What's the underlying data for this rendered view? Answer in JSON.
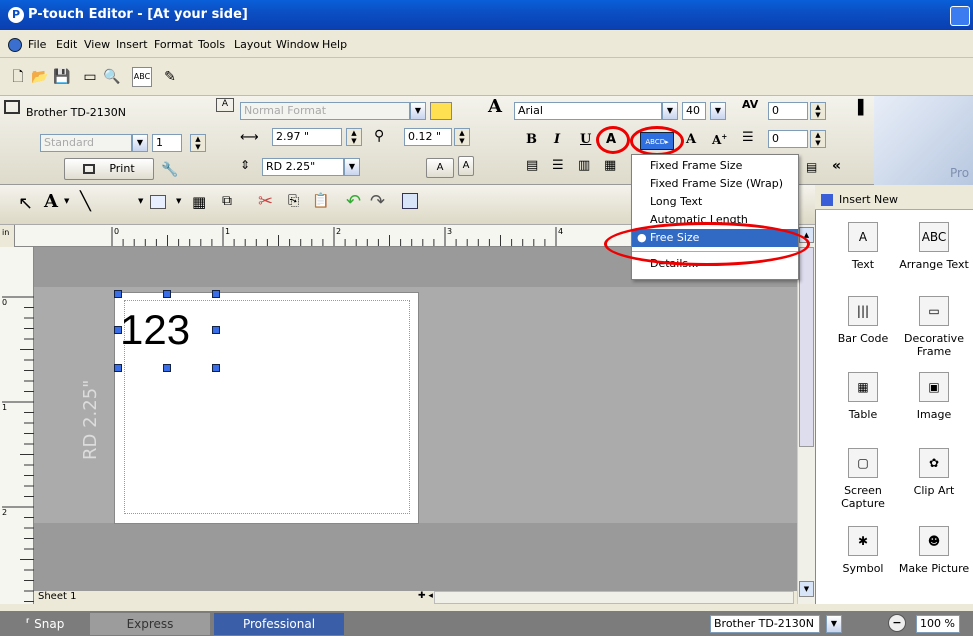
{
  "window": {
    "title": "P-touch Editor - [At your side]"
  },
  "menu": [
    "File",
    "Edit",
    "View",
    "Insert",
    "Format",
    "Tools",
    "Layout",
    "Window",
    "Help"
  ],
  "printer": {
    "name": "Brother TD-2130N",
    "mode": "Standard",
    "copies": "1",
    "print_label": "Print"
  },
  "paper": {
    "format": "Normal Format",
    "width": "2.97 \"",
    "margin": "0.12 \"",
    "media": "RD 2.25\""
  },
  "font": {
    "name": "Arial",
    "size": "40",
    "spacing1": "0",
    "spacing2": "0"
  },
  "dropdown": {
    "items": [
      "Fixed Frame Size",
      "Fixed Frame Size (Wrap)",
      "Long Text",
      "Automatic Length",
      "Free Size",
      "Details..."
    ],
    "selected": "Free Size"
  },
  "ruler": {
    "unit": "in",
    "ticks": [
      "0",
      "1",
      "2",
      "3",
      "4"
    ],
    "vticks": [
      "0",
      "1",
      "2"
    ]
  },
  "canvas": {
    "text": "123",
    "side_label": "RD 2.25\"",
    "sheet_tab": "Sheet 1"
  },
  "panel": {
    "title": "Insert New",
    "pro_text": "Pro",
    "items": [
      {
        "label": "Text",
        "icon": "A"
      },
      {
        "label": "Arrange Text",
        "icon": "ABC"
      },
      {
        "label": "Bar Code",
        "icon": "|||"
      },
      {
        "label": "Decorative\nFrame",
        "icon": "▭"
      },
      {
        "label": "Table",
        "icon": "▦"
      },
      {
        "label": "Image",
        "icon": "▣"
      },
      {
        "label": "Screen\nCapture",
        "icon": "▢"
      },
      {
        "label": "Clip Art",
        "icon": "✿"
      },
      {
        "label": "Symbol",
        "icon": "✱"
      },
      {
        "label": "Make Picture",
        "icon": "☻"
      }
    ]
  },
  "status": {
    "snap": "Snap",
    "express": "Express",
    "professional": "Professional",
    "printer": "Brother TD-2130N",
    "zoom": "100 %"
  },
  "colors": {
    "title_bar": "#0a4fc4",
    "highlight": "#316ac5",
    "oval": "#e00000"
  }
}
